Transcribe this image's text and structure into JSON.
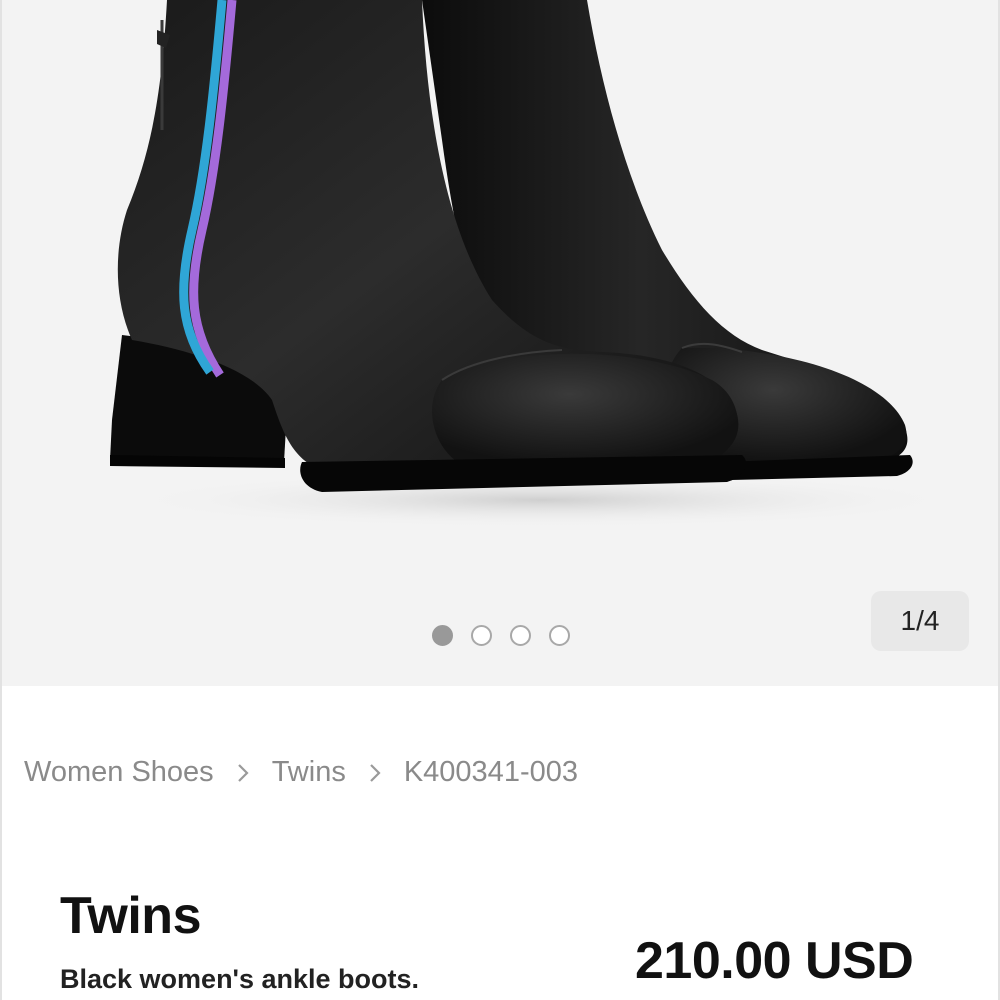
{
  "gallery": {
    "image_alt": "Black women's ankle boots",
    "counter": "1/4",
    "total_slides": 4,
    "active_slide": 1
  },
  "breadcrumb": {
    "items": [
      "Women Shoes",
      "Twins",
      "K400341-003"
    ]
  },
  "product": {
    "title": "Twins",
    "subtitle": "Black women's ankle boots.",
    "price": "210.00 USD"
  },
  "colors": {
    "stripe_blue": "#2fa6d6",
    "stripe_purple": "#a46adb",
    "leather": "#141414"
  }
}
